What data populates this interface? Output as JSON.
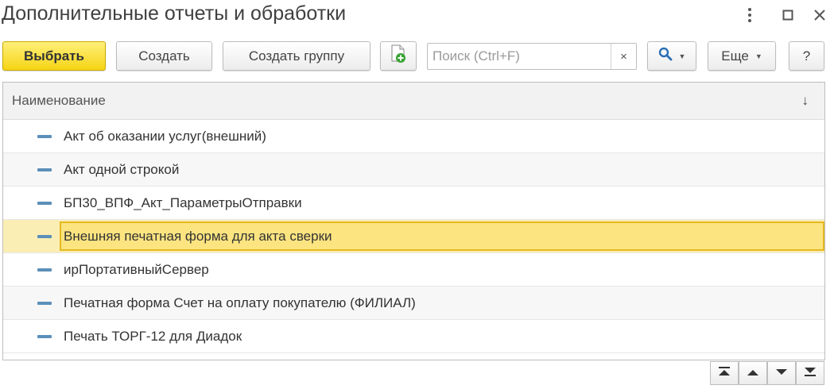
{
  "window": {
    "title": "Дополнительные отчеты и обработки",
    "icons": [
      "more-vertical-icon",
      "maximize-icon",
      "close-icon"
    ]
  },
  "toolbar": {
    "select_label": "Выбрать",
    "create_label": "Создать",
    "create_group_label": "Создать группу",
    "search_placeholder": "Поиск (Ctrl+F)",
    "search_value": "",
    "clear_symbol": "×",
    "more_label": "Еще",
    "help_label": "?",
    "primary_color": "#f5d415"
  },
  "table": {
    "column_header": "Наименование",
    "sort_symbol": "↓",
    "rows": [
      {
        "label": "Акт об оказании услуг(внешний)"
      },
      {
        "label": "Акт одной строкой"
      },
      {
        "label": "БП30_ВПФ_Акт_ПараметрыОтправки"
      },
      {
        "label": "Внешняя печатная форма для акта сверки",
        "selected": true
      },
      {
        "label": "ирПортативныйСервер"
      },
      {
        "label": "Печатная форма Счет на оплату покупателю (ФИЛИАЛ)"
      },
      {
        "label": "Печать ТОРГ-12 для Диадок"
      }
    ],
    "selected_color": "#fce480"
  }
}
